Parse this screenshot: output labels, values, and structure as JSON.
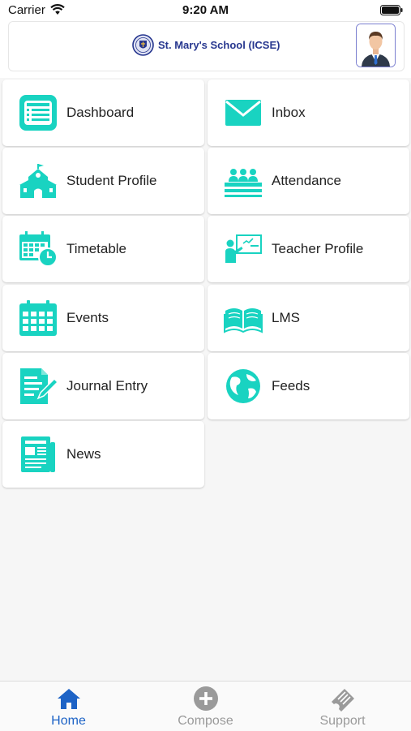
{
  "status_bar": {
    "carrier": "Carrier",
    "time": "9:20 AM"
  },
  "header": {
    "school_name": "St. Mary's School (ICSE)"
  },
  "menu": [
    {
      "label": "Dashboard",
      "icon": "dashboard-icon"
    },
    {
      "label": "Inbox",
      "icon": "envelope-icon"
    },
    {
      "label": "Student Profile",
      "icon": "school-building-icon"
    },
    {
      "label": "Attendance",
      "icon": "classroom-icon"
    },
    {
      "label": "Timetable",
      "icon": "calendar-clock-icon"
    },
    {
      "label": "Teacher Profile",
      "icon": "teacher-board-icon"
    },
    {
      "label": "Events",
      "icon": "calendar-icon"
    },
    {
      "label": "LMS",
      "icon": "open-book-icon"
    },
    {
      "label": "Journal Entry",
      "icon": "journal-pen-icon"
    },
    {
      "label": "Feeds",
      "icon": "globe-icon"
    },
    {
      "label": "News",
      "icon": "newspaper-icon"
    }
  ],
  "tabs": [
    {
      "label": "Home",
      "icon": "home-icon",
      "active": true
    },
    {
      "label": "Compose",
      "icon": "plus-circle-icon",
      "active": false
    },
    {
      "label": "Support",
      "icon": "ticket-icon",
      "active": false
    }
  ],
  "colors": {
    "accent": "#19d3c1",
    "tab_active": "#1d63c6",
    "tab_inactive": "#9a9a9a",
    "school_text": "#27378f"
  }
}
